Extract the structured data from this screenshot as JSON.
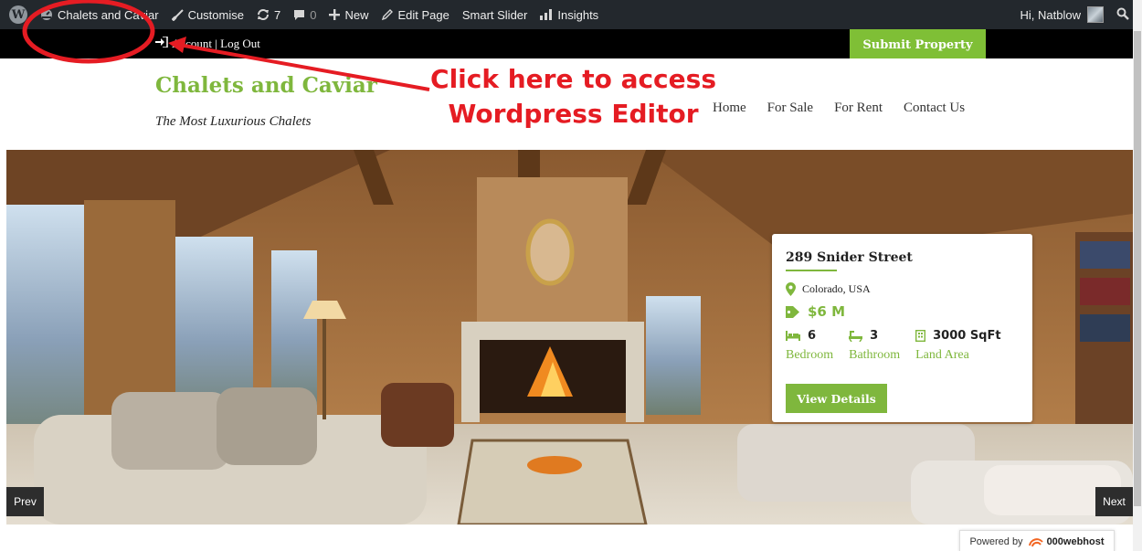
{
  "admin_bar": {
    "site_name": "Chalets and Caviar",
    "customise": "Customise",
    "updates_count": "7",
    "comments_count": "0",
    "new": "New",
    "edit_page": "Edit Page",
    "smart_slider": "Smart Slider",
    "insights": "Insights",
    "greeting": "Hi, Natblow"
  },
  "account_bar": {
    "account_text": "Account | Log Out",
    "submit_property": "Submit Property"
  },
  "header": {
    "site_title": "Chalets and Caviar",
    "tagline": "The Most Luxurious Chalets",
    "nav": [
      "Home",
      "For Sale",
      "For Rent",
      "Contact Us"
    ]
  },
  "annotation": {
    "line1": "Click here to access",
    "line2": "Wordpress Editor",
    "color": "#e51c23"
  },
  "property_card": {
    "title": "289 Snider Street",
    "location": "Colorado, USA",
    "price": "$6 M",
    "features": [
      {
        "value": "6",
        "label": "Bedroom",
        "icon": "bed-icon"
      },
      {
        "value": "3",
        "label": "Bathroom",
        "icon": "bathtub-icon"
      },
      {
        "value": "3000 SqFt",
        "label": "Land Area",
        "icon": "building-icon"
      }
    ],
    "button": "View Details"
  },
  "slider": {
    "prev": "Prev",
    "next": "Next"
  },
  "footer": {
    "powered_by": "Powered by",
    "host_brand": "000webhost"
  },
  "colors": {
    "accent_green": "#7fb73d",
    "admin_bar_bg": "#23282d"
  }
}
